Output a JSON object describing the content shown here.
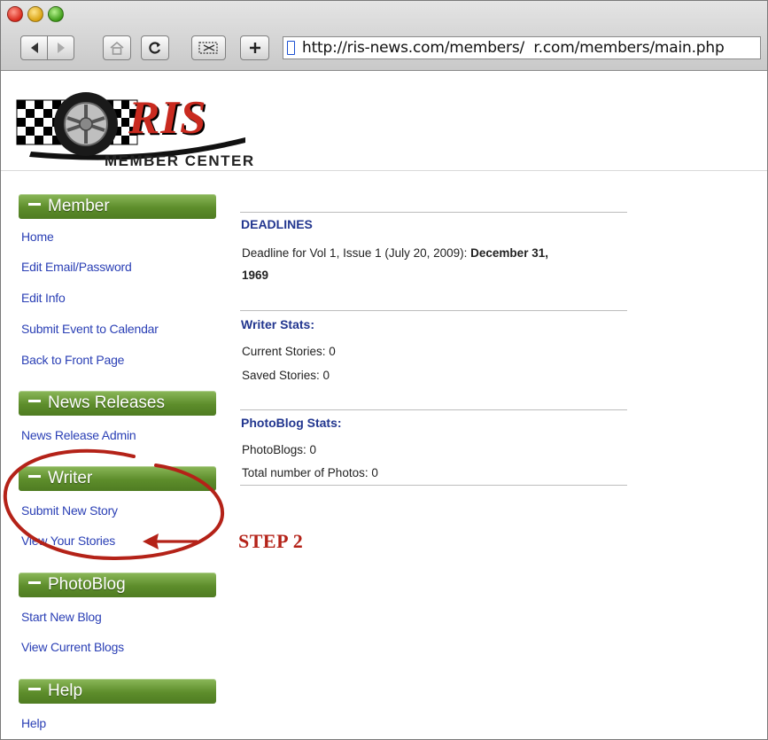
{
  "browser": {
    "url": "http://ris-news.com/members/  r.com/members/main.php",
    "buttons": {
      "back": "back-arrow",
      "forward": "forward-arrow",
      "home": "home-icon",
      "reload": "reload-icon",
      "clip": "clip-icon",
      "add": "plus-icon"
    }
  },
  "header": {
    "logo_text": "RIS",
    "subtitle": "Member Center"
  },
  "sidebar": {
    "sections": [
      {
        "title": "Member",
        "links": [
          "Home",
          "Edit Email/Password",
          "Edit Info",
          "Submit Event to Calendar",
          "Back to Front Page"
        ]
      },
      {
        "title": "News Releases",
        "links": [
          "News Release Admin"
        ]
      },
      {
        "title": "Writer",
        "links": [
          "Submit New Story",
          "View Your Stories"
        ]
      },
      {
        "title": "PhotoBlog",
        "links": [
          "Start New Blog",
          "View Current Blogs"
        ]
      },
      {
        "title": "Help",
        "links": [
          "Help"
        ]
      }
    ]
  },
  "main": {
    "deadlines": {
      "title": "DEADLINES",
      "text": "Deadline for Vol 1, Issue 1 (July 20, 2009): ",
      "date_line1": "December 31,",
      "date_line2": "1969"
    },
    "writer_stats": {
      "title": "Writer Stats:",
      "current": "Current Stories: 0",
      "saved": "Saved Stories: 0"
    },
    "photoblog_stats": {
      "title": "PhotoBlog Stats:",
      "blogs": "PhotoBlogs: 0",
      "photos": "Total number of Photos: 0"
    }
  },
  "annotation": {
    "step_label": "STEP 2",
    "color": "#b42218"
  },
  "colors": {
    "link": "#2a3fb5",
    "section_title": "#22368f",
    "sidebar_header": "#5d8d2b"
  }
}
